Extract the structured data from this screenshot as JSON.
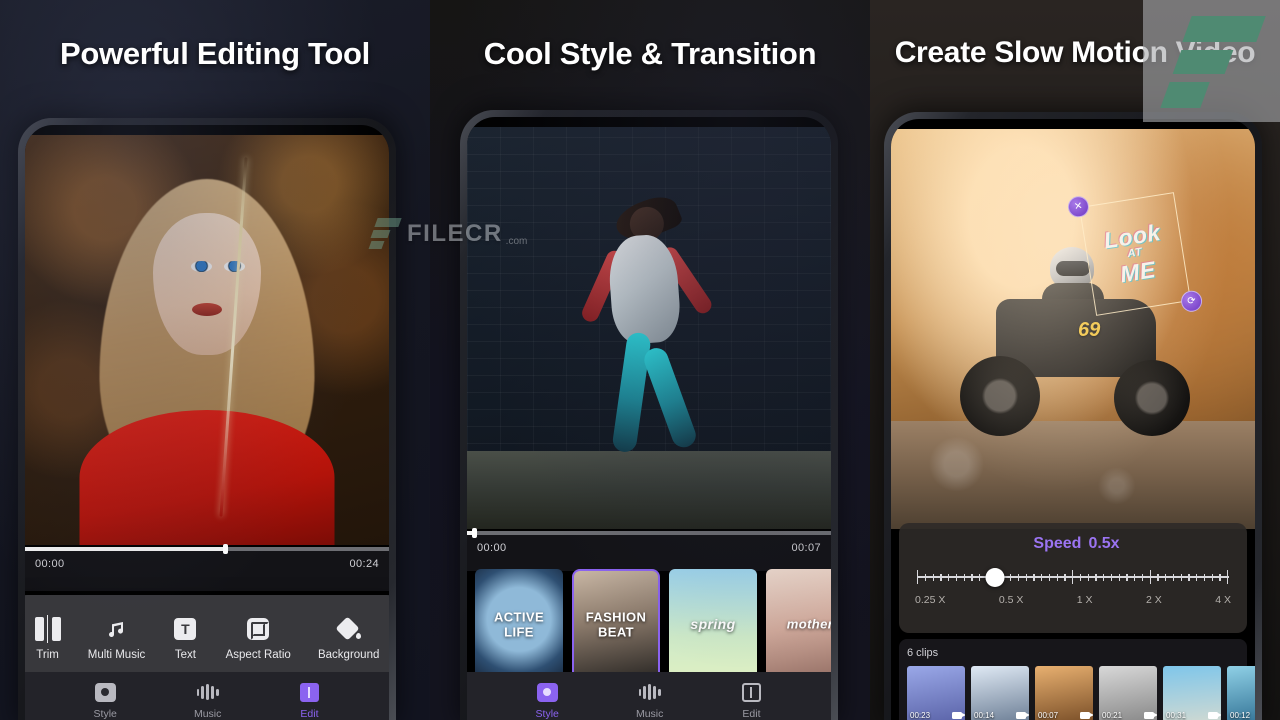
{
  "panels": [
    {
      "heading": "Powerful Editing Tool",
      "timeline": {
        "start": "00:00",
        "end": "00:24",
        "progress_percent": 55
      },
      "toolbar": [
        {
          "label": "Trim",
          "icon": "trim-icon"
        },
        {
          "label": "Multi Music",
          "icon": "music-note-icon"
        },
        {
          "label": "Text",
          "icon": "text-icon"
        },
        {
          "label": "Aspect Ratio",
          "icon": "aspect-ratio-icon"
        },
        {
          "label": "Background",
          "icon": "paint-bucket-icon"
        }
      ],
      "bottom_nav": [
        {
          "label": "Style",
          "icon": "style-icon",
          "active": false
        },
        {
          "label": "Music",
          "icon": "waveform-icon",
          "active": false
        },
        {
          "label": "Edit",
          "icon": "edit-icon",
          "active": true
        }
      ]
    },
    {
      "heading": "Cool Style & Transition",
      "timeline": {
        "start": "00:00",
        "end": "00:07",
        "progress_percent": 2
      },
      "styles": [
        {
          "label": "ACTIVE\nLIFE",
          "selected": false
        },
        {
          "label": "FASHION\nBEAT",
          "selected": true
        },
        {
          "label": "spring",
          "selected": false
        },
        {
          "label": "mother",
          "selected": false
        }
      ],
      "bottom_nav": [
        {
          "label": "Style",
          "icon": "style-icon",
          "active": true
        },
        {
          "label": "Music",
          "icon": "waveform-icon",
          "active": false
        },
        {
          "label": "Edit",
          "icon": "edit-icon",
          "active": false
        }
      ]
    },
    {
      "heading": "Create Slow Motion Video",
      "sticker": {
        "line1": "Look",
        "line2_small": "AT",
        "line3": "ME"
      },
      "speed": {
        "label": "Speed",
        "value": "0.5x",
        "accent_color": "#9b74f2",
        "knob_percent": 25,
        "tick_labels": [
          "0.25 X",
          "0.5 X",
          "1 X",
          "2 X",
          "4 X"
        ]
      },
      "clips": {
        "title": "6 clips",
        "items": [
          {
            "duration": "00:23"
          },
          {
            "duration": "00:14"
          },
          {
            "duration": "00:07"
          },
          {
            "duration": "00:21"
          },
          {
            "duration": "00:31"
          },
          {
            "duration": "00:12"
          }
        ]
      }
    }
  ],
  "watermark": {
    "word": "FILECR",
    "suffix": ".com",
    "brand_green": "#4f8a72"
  },
  "atv": {
    "number": "69"
  }
}
